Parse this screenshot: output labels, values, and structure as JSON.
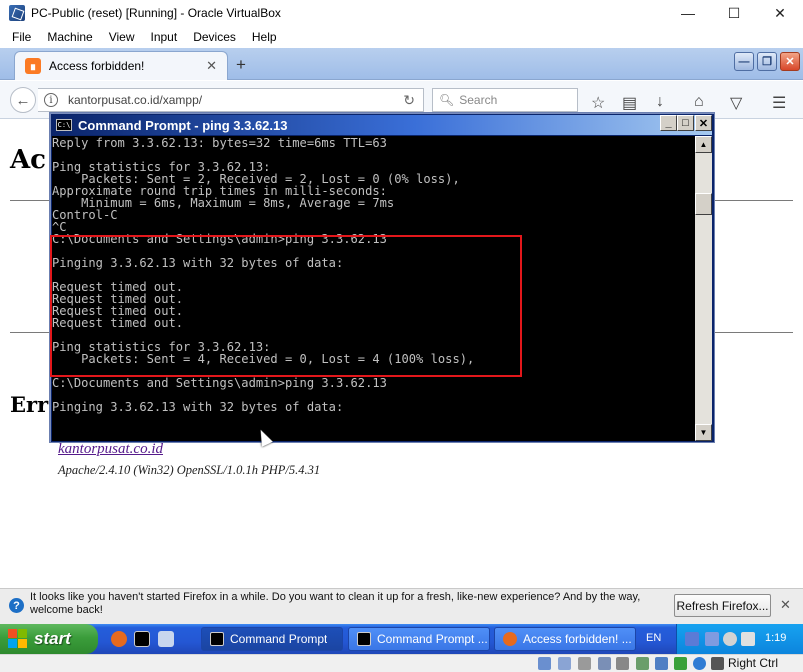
{
  "vbox": {
    "title": "PC-Public (reset) [Running] - Oracle VirtualBox",
    "menu": [
      "File",
      "Machine",
      "View",
      "Input",
      "Devices",
      "Help"
    ],
    "host_key": "Right Ctrl"
  },
  "firefox": {
    "tab_label": "Access forbidden!",
    "url": "kantorpusat.co.id/xampp/",
    "search_placeholder": "Search",
    "notice_text": "It looks like you haven't started Firefox in a while. Do you want to clean it up for a fresh, like-new experience? And by the way, welcome back!",
    "refresh_button": "Refresh Firefox..."
  },
  "page": {
    "heading_partial": "Ac",
    "subheading_partial": "Err",
    "link": "kantorpusat.co.id",
    "server_info": "Apache/2.4.10 (Win32) OpenSSL/1.0.1h PHP/5.4.31"
  },
  "cmd": {
    "title": "Command Prompt - ping 3.3.62.13",
    "lines": [
      "Reply from 3.3.62.13: bytes=32 time=6ms TTL=63",
      "",
      "Ping statistics for 3.3.62.13:",
      "    Packets: Sent = 2, Received = 2, Lost = 0 (0% loss),",
      "Approximate round trip times in milli-seconds:",
      "    Minimum = 6ms, Maximum = 8ms, Average = 7ms",
      "Control-C",
      "^C",
      "C:\\Documents and Settings\\admin>ping 3.3.62.13",
      "",
      "Pinging 3.3.62.13 with 32 bytes of data:",
      "",
      "Request timed out.",
      "Request timed out.",
      "Request timed out.",
      "Request timed out.",
      "",
      "Ping statistics for 3.3.62.13:",
      "    Packets: Sent = 4, Received = 0, Lost = 4 (100% loss),",
      "",
      "C:\\Documents and Settings\\admin>ping 3.3.62.13",
      "",
      "Pinging 3.3.62.13 with 32 bytes of data:"
    ]
  },
  "taskbar": {
    "start_label": "start",
    "buttons": [
      "Command Prompt",
      "Command Prompt ...",
      "Access forbidden! ..."
    ],
    "lang": "EN",
    "clock": "1:19"
  },
  "colors": {
    "highlight": "#e3171b",
    "cmd_text": "#c0c0c0",
    "xp_blue": "#245edb",
    "start_green": "#3b9d3b"
  }
}
